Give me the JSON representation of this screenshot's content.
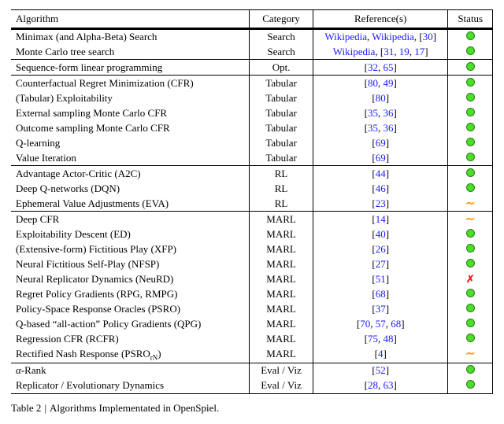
{
  "headers": {
    "algorithm": "Algorithm",
    "category": "Category",
    "references": "Reference(s)",
    "status": "Status"
  },
  "status_legend": {
    "ok": "green-dot",
    "partial": "tilde",
    "fail": "cross"
  },
  "groups": [
    {
      "rows": [
        {
          "algorithm": "Minimax (and Alpha-Beta) Search",
          "category": "Search",
          "refs": [
            {
              "text": "Wikipedia",
              "type": "link"
            },
            {
              "text": "Wikipedia",
              "type": "link"
            },
            {
              "text": "30",
              "type": "cite"
            }
          ],
          "status": "ok"
        },
        {
          "algorithm": "Monte Carlo tree search",
          "category": "Search",
          "refs": [
            {
              "text": "Wikipedia",
              "type": "link"
            },
            {
              "text": "31",
              "type": "cite"
            },
            {
              "text": "19",
              "type": "cite"
            },
            {
              "text": "17",
              "type": "cite"
            }
          ],
          "status": "ok"
        }
      ]
    },
    {
      "rows": [
        {
          "algorithm": "Sequence-form linear programming",
          "category": "Opt.",
          "refs": [
            {
              "text": "32",
              "type": "cite"
            },
            {
              "text": "65",
              "type": "cite"
            }
          ],
          "status": "ok"
        }
      ]
    },
    {
      "rows": [
        {
          "algorithm": "Counterfactual Regret Minimization (CFR)",
          "category": "Tabular",
          "refs": [
            {
              "text": "80",
              "type": "cite"
            },
            {
              "text": "49",
              "type": "cite"
            }
          ],
          "status": "ok"
        },
        {
          "algorithm": "(Tabular) Exploitability",
          "category": "Tabular",
          "refs": [
            {
              "text": "80",
              "type": "cite"
            }
          ],
          "status": "ok"
        },
        {
          "algorithm": "External sampling Monte Carlo CFR",
          "category": "Tabular",
          "refs": [
            {
              "text": "35",
              "type": "cite"
            },
            {
              "text": "36",
              "type": "cite"
            }
          ],
          "status": "ok"
        },
        {
          "algorithm": "Outcome sampling Monte Carlo CFR",
          "category": "Tabular",
          "refs": [
            {
              "text": "35",
              "type": "cite"
            },
            {
              "text": "36",
              "type": "cite"
            }
          ],
          "status": "ok"
        },
        {
          "algorithm": "Q-learning",
          "category": "Tabular",
          "refs": [
            {
              "text": "69",
              "type": "cite"
            }
          ],
          "status": "ok"
        },
        {
          "algorithm": "Value Iteration",
          "category": "Tabular",
          "refs": [
            {
              "text": "69",
              "type": "cite"
            }
          ],
          "status": "ok"
        }
      ]
    },
    {
      "rows": [
        {
          "algorithm": "Advantage Actor-Critic (A2C)",
          "category": "RL",
          "refs": [
            {
              "text": "44",
              "type": "cite"
            }
          ],
          "status": "ok"
        },
        {
          "algorithm": "Deep Q-networks (DQN)",
          "category": "RL",
          "refs": [
            {
              "text": "46",
              "type": "cite"
            }
          ],
          "status": "ok"
        },
        {
          "algorithm": "Ephemeral Value Adjustments (EVA)",
          "category": "RL",
          "refs": [
            {
              "text": "23",
              "type": "cite"
            }
          ],
          "status": "partial"
        }
      ]
    },
    {
      "rows": [
        {
          "algorithm": "Deep CFR",
          "category": "MARL",
          "refs": [
            {
              "text": "14",
              "type": "cite"
            }
          ],
          "status": "partial"
        },
        {
          "algorithm": "Exploitability Descent (ED)",
          "category": "MARL",
          "refs": [
            {
              "text": "40",
              "type": "cite"
            }
          ],
          "status": "ok"
        },
        {
          "algorithm": "(Extensive-form) Fictitious Play (XFP)",
          "category": "MARL",
          "refs": [
            {
              "text": "26",
              "type": "cite"
            }
          ],
          "status": "ok"
        },
        {
          "algorithm": "Neural Fictitious Self-Play (NFSP)",
          "category": "MARL",
          "refs": [
            {
              "text": "27",
              "type": "cite"
            }
          ],
          "status": "ok"
        },
        {
          "algorithm": "Neural Replicator Dynamics (NeuRD)",
          "category": "MARL",
          "refs": [
            {
              "text": "51",
              "type": "cite"
            }
          ],
          "status": "fail"
        },
        {
          "algorithm": "Regret Policy Gradients (RPG, RMPG)",
          "category": "MARL",
          "refs": [
            {
              "text": "68",
              "type": "cite"
            }
          ],
          "status": "ok"
        },
        {
          "algorithm": "Policy-Space Response Oracles (PSRO)",
          "category": "MARL",
          "refs": [
            {
              "text": "37",
              "type": "cite"
            }
          ],
          "status": "ok"
        },
        {
          "algorithm": "Q-based “all-action” Policy Gradients (QPG)",
          "category": "MARL",
          "refs": [
            {
              "text": "70",
              "type": "cite"
            },
            {
              "text": "57",
              "type": "cite"
            },
            {
              "text": "68",
              "type": "cite"
            }
          ],
          "status": "ok"
        },
        {
          "algorithm": "Regression CFR (RCFR)",
          "category": "MARL",
          "refs": [
            {
              "text": "75",
              "type": "cite"
            },
            {
              "text": "48",
              "type": "cite"
            }
          ],
          "status": "ok"
        },
        {
          "algorithm_html": "Rectified Nash Response (PSRO<span class=\"sub\">rN</span>)",
          "algorithm": "Rectified Nash Response (PSRO_rN)",
          "category": "MARL",
          "refs": [
            {
              "text": "4",
              "type": "cite"
            }
          ],
          "status": "partial"
        }
      ]
    },
    {
      "rows": [
        {
          "algorithm_html": "<i>α</i>-Rank",
          "algorithm": "α-Rank",
          "category": "Eval / Viz",
          "refs": [
            {
              "text": "52",
              "type": "cite"
            }
          ],
          "status": "ok"
        },
        {
          "algorithm": "Replicator / Evolutionary Dynamics",
          "category": "Eval / Viz",
          "refs": [
            {
              "text": "28",
              "type": "cite"
            },
            {
              "text": "63",
              "type": "cite"
            }
          ],
          "status": "ok"
        }
      ]
    }
  ],
  "caption": {
    "label": "Table 2",
    "text": "Algorithms Implementated in OpenSpiel."
  }
}
